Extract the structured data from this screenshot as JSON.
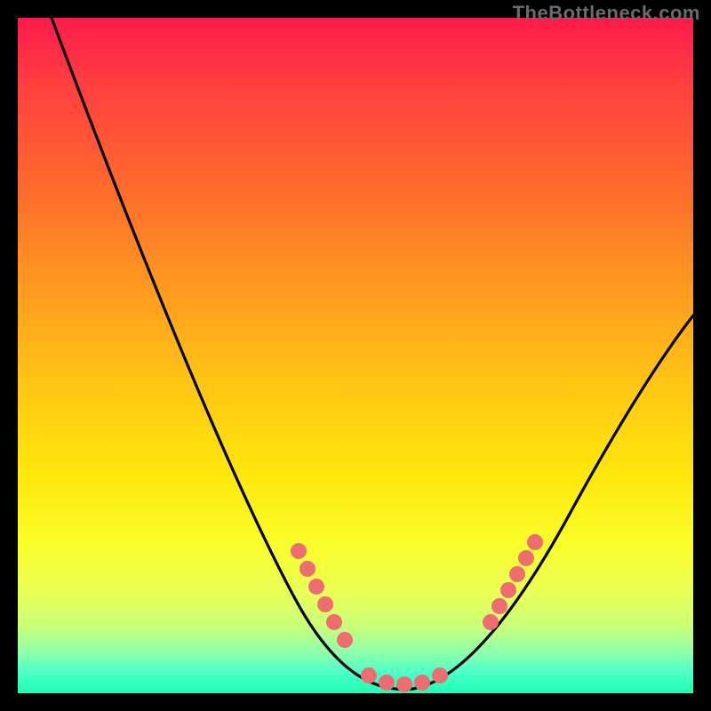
{
  "watermark": "TheBottleneck.com",
  "chart_data": {
    "type": "line",
    "title": "",
    "xlabel": "",
    "ylabel": "",
    "xlim": [
      0,
      100
    ],
    "ylim": [
      0,
      100
    ],
    "grid": false,
    "series": [
      {
        "name": "curve",
        "color": "#000000",
        "x": [
          5,
          10,
          15,
          20,
          25,
          30,
          35,
          40,
          45,
          50,
          55,
          60,
          65,
          70,
          75,
          80,
          85,
          90,
          95,
          100
        ],
        "y": [
          100,
          90,
          80,
          70,
          59,
          48,
          36,
          24,
          14,
          6,
          1,
          0,
          1,
          5,
          12,
          20,
          28,
          36,
          44,
          52
        ]
      },
      {
        "name": "marker-dots",
        "color": "#ef6d71",
        "type": "scatter",
        "x": [
          41,
          43,
          45,
          47,
          52,
          54,
          57,
          60,
          62,
          64,
          67,
          70,
          72,
          74,
          76
        ],
        "y": [
          21,
          17,
          13,
          10,
          4,
          2,
          1,
          0,
          1,
          2,
          5,
          10,
          14,
          18,
          23
        ]
      }
    ],
    "background_gradient": {
      "top": "#ff1b4b",
      "mid": "#ffe80b",
      "bottom": "#1cffb4"
    }
  }
}
